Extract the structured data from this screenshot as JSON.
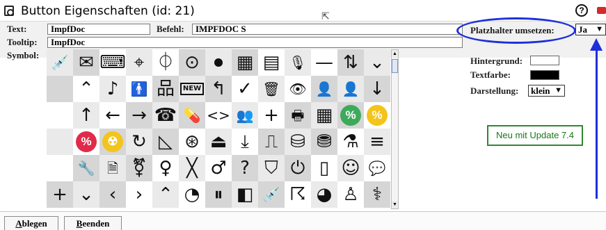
{
  "window": {
    "title": "Button Eigenschaften (id: 21)",
    "help_label": "?"
  },
  "form": {
    "text_label": "Text:",
    "text_value": "ImpfDoc",
    "befehl_label": "Befehl:",
    "befehl_value": "IMPFDOC S",
    "tooltip_label": "Tooltip:",
    "tooltip_value": "ImpfDoc",
    "symbol_label": "Symbol:",
    "platzhalter_label": "Platzhalter umsetzen:",
    "platzhalter_value": "Ja",
    "hintergrund_label": "Hintergrund:",
    "hintergrund_color": "#ffffff",
    "textfarbe_label": "Textfarbe:",
    "textfarbe_color": "#000000",
    "darstellung_label": "Darstellung:",
    "darstellung_value": "klein"
  },
  "annotation": {
    "note": "Neu mit Update 7.4",
    "highlight_color": "#1f2fd9",
    "note_color": "#2d8a2d"
  },
  "buttons": {
    "ablegen_first": "A",
    "ablegen_rest": "blegen",
    "beenden_first": "B",
    "beenden_rest": "eenden"
  },
  "symbols": {
    "rows": [
      [
        {
          "name": "syringe-icon",
          "glyph": "💉"
        },
        {
          "name": "mail-check-icon",
          "glyph": "✉"
        },
        {
          "name": "keyboard-icon",
          "glyph": "⌨"
        },
        {
          "name": "map-person-icon",
          "glyph": "⌖"
        },
        {
          "name": "mouse-icon",
          "glyph": "⏀"
        },
        {
          "name": "target-icon",
          "glyph": "⊙"
        },
        {
          "name": "stop-circle-icon",
          "glyph": "⏺"
        },
        {
          "name": "dashboard-icon",
          "glyph": "▦"
        },
        {
          "name": "message-icon",
          "glyph": "▤"
        },
        {
          "name": "microphone-icon",
          "glyph": "🎙"
        },
        {
          "name": "minus-icon",
          "glyph": "—"
        },
        {
          "name": "sort-az-icon",
          "glyph": "⇅"
        },
        {
          "name": "chevron-down-icon",
          "glyph": "⌄"
        }
      ],
      [
        {
          "name": "blank-icon",
          "glyph": ""
        },
        {
          "name": "chevron-up-icon",
          "glyph": "⌃"
        },
        {
          "name": "music-note-icon",
          "glyph": "♪"
        },
        {
          "name": "person-standing-icon",
          "glyph": "🚹"
        },
        {
          "name": "network-icon",
          "glyph": "品"
        },
        {
          "name": "new-badge-icon",
          "glyph": "NEW"
        },
        {
          "name": "return-arrow-icon",
          "glyph": "↰"
        },
        {
          "name": "checkmark-icon",
          "glyph": "✓"
        },
        {
          "name": "trash-icon",
          "glyph": "🗑"
        },
        {
          "name": "eye-icon",
          "glyph": "👁"
        },
        {
          "name": "user-icon",
          "glyph": "👤"
        },
        {
          "name": "user-solid-icon",
          "glyph": "👤"
        },
        {
          "name": "arrow-down-icon",
          "glyph": "↓"
        }
      ],
      [
        {
          "name": "blank-icon",
          "glyph": ""
        },
        {
          "name": "arrow-up-icon",
          "glyph": "↑"
        },
        {
          "name": "arrow-left-icon",
          "glyph": "←"
        },
        {
          "name": "arrow-right-icon",
          "glyph": "→"
        },
        {
          "name": "telephone-icon",
          "glyph": "☎"
        },
        {
          "name": "pills-icon",
          "glyph": "💊"
        },
        {
          "name": "code-icon",
          "glyph": "<>"
        },
        {
          "name": "users-icon",
          "glyph": "👥"
        },
        {
          "name": "plus-icon",
          "glyph": "+"
        },
        {
          "name": "printer-icon",
          "glyph": "🖶"
        },
        {
          "name": "table-grid-icon",
          "glyph": "▦"
        },
        {
          "name": "percent-green-icon",
          "glyph": "%"
        },
        {
          "name": "percent-yellow-icon",
          "glyph": "%"
        }
      ],
      [
        {
          "name": "blank-icon",
          "glyph": ""
        },
        {
          "name": "percent-red-icon",
          "glyph": "%"
        },
        {
          "name": "radiation-icon",
          "glyph": "☢"
        },
        {
          "name": "refresh-icon",
          "glyph": "↻"
        },
        {
          "name": "angle-ruler-icon",
          "glyph": "◺"
        },
        {
          "name": "lifebuoy-icon",
          "glyph": "⊛"
        },
        {
          "name": "router-icon",
          "glyph": "⏏"
        },
        {
          "name": "download-icon",
          "glyph": "⤓"
        },
        {
          "name": "scanner-icon",
          "glyph": "⎍"
        },
        {
          "name": "database-down-icon",
          "glyph": "⛁"
        },
        {
          "name": "database-up-icon",
          "glyph": "⛃"
        },
        {
          "name": "flask-icon",
          "glyph": "⚗"
        },
        {
          "name": "list-search-icon",
          "glyph": "≡"
        }
      ],
      [
        {
          "name": "blank-icon",
          "glyph": ""
        },
        {
          "name": "wrench-icon",
          "glyph": "🔧"
        },
        {
          "name": "document-search-icon",
          "glyph": "🗎"
        },
        {
          "name": "transgender-icon",
          "glyph": "⚧"
        },
        {
          "name": "female-icon",
          "glyph": "♀"
        },
        {
          "name": "cross-icon",
          "glyph": "╳"
        },
        {
          "name": "male-icon",
          "glyph": "♂"
        },
        {
          "name": "question-icon",
          "glyph": "?"
        },
        {
          "name": "shield-icon",
          "glyph": "⛉"
        },
        {
          "name": "power-icon",
          "glyph": "⏻"
        },
        {
          "name": "smartphone-icon",
          "glyph": "▯"
        },
        {
          "name": "smiley-icon",
          "glyph": "☺"
        },
        {
          "name": "chat-icon",
          "glyph": "💬"
        }
      ],
      [
        {
          "name": "plus-large-icon",
          "glyph": "+"
        },
        {
          "name": "chevron-down-icon",
          "glyph": "⌄"
        },
        {
          "name": "chevron-left-icon",
          "glyph": "‹"
        },
        {
          "name": "chevron-right-icon",
          "glyph": "›"
        },
        {
          "name": "chevron-up-icon",
          "glyph": "⌃"
        },
        {
          "name": "gauge-icon",
          "glyph": "◔"
        },
        {
          "name": "pause-icon",
          "glyph": "⏸"
        },
        {
          "name": "split-panel-icon",
          "glyph": "◧"
        },
        {
          "name": "syringe-icon",
          "glyph": "💉"
        },
        {
          "name": "fingerprint-icon",
          "glyph": "☈"
        },
        {
          "name": "pie-chart-icon",
          "glyph": "◕"
        },
        {
          "name": "stamp-icon",
          "glyph": "♙"
        },
        {
          "name": "stethoscope-icon",
          "glyph": "⚕"
        }
      ]
    ]
  }
}
